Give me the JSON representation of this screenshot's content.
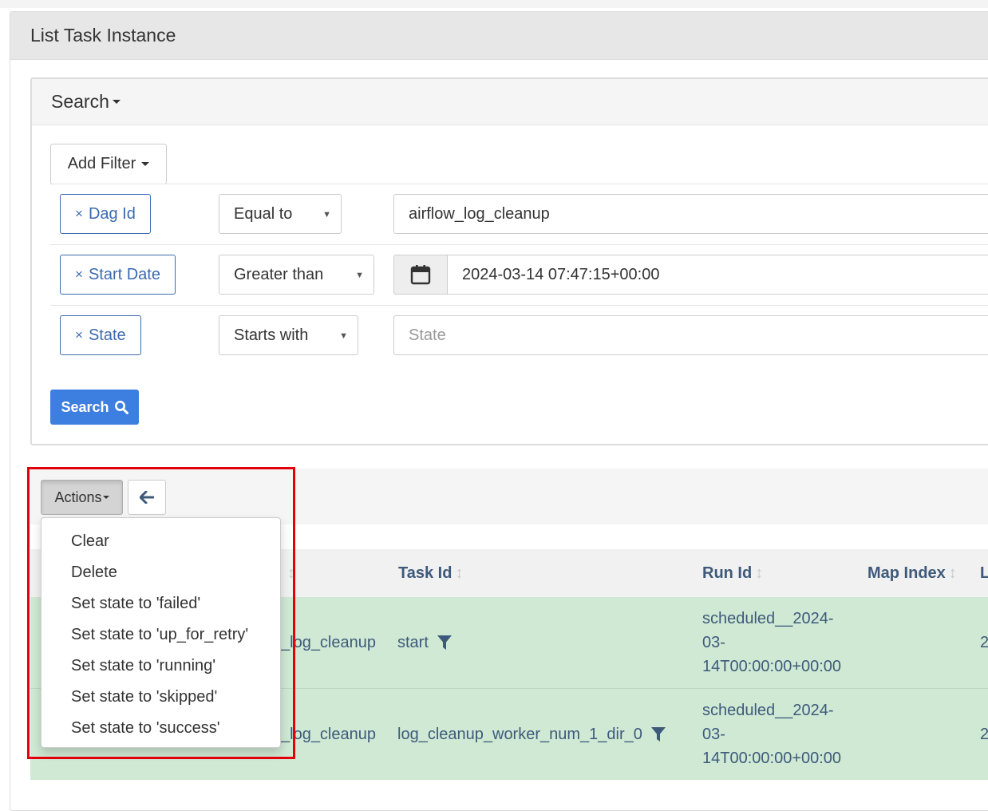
{
  "page": {
    "title": "List Task Instance"
  },
  "search": {
    "header": "Search",
    "add_filter_label": "Add Filter",
    "filters": [
      {
        "label": "Dag Id",
        "operator": "Equal to",
        "value": "airflow_log_cleanup",
        "placeholder": ""
      },
      {
        "label": "Start Date",
        "operator": "Greater than",
        "value": "2024-03-14 07:47:15+00:00",
        "placeholder": ""
      },
      {
        "label": "State",
        "operator": "Starts with",
        "value": "",
        "placeholder": "State"
      }
    ],
    "remove_symbol": "×",
    "submit_label": "Search"
  },
  "actions": {
    "button_label": "Actions",
    "menu": [
      "Clear",
      "Delete",
      "Set state to 'failed'",
      "Set state to 'up_for_retry'",
      "Set state to 'running'",
      "Set state to 'skipped'",
      "Set state to 'success'"
    ]
  },
  "table": {
    "columns": [
      "Task Id",
      "Run Id",
      "Map Index",
      "L"
    ],
    "rows": [
      {
        "dag_fragment": "_log_cleanup",
        "task_id": "start",
        "run_id_lines": [
          "scheduled__2024-",
          "03-",
          "14T00:00:00+00:00"
        ],
        "last_fragment": "2"
      },
      {
        "dag_fragment": "_log_cleanup",
        "task_id": "log_cleanup_worker_num_1_dir_0",
        "run_id_lines": [
          "scheduled__2024-",
          "03-",
          "14T00:00:00+00:00"
        ],
        "last_fragment": "2"
      }
    ]
  },
  "colors": {
    "primary": "#3d7fe0",
    "row_success": "#cfe9d4",
    "link": "#3e5a7a",
    "filter_label": "#3b6ab0",
    "highlight": "#e3000b"
  },
  "icons": {
    "search_caret": "caret-down-icon",
    "calendar": "calendar-icon",
    "search_button": "magnifier-icon",
    "back": "arrow-left-icon",
    "filter": "funnel-icon",
    "sort": "sort-icon"
  }
}
